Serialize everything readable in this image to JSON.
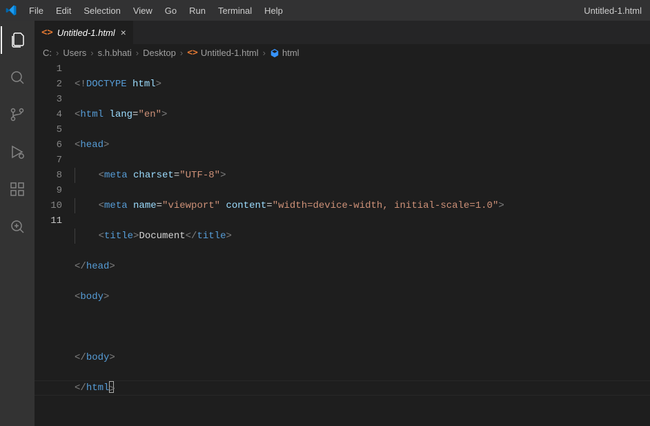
{
  "titlebar": {
    "title": "Untitled-1.html",
    "menu": [
      "File",
      "Edit",
      "Selection",
      "View",
      "Go",
      "Run",
      "Terminal",
      "Help"
    ]
  },
  "activitybar": {
    "items": [
      {
        "name": "explorer"
      },
      {
        "name": "search"
      },
      {
        "name": "source-control"
      },
      {
        "name": "run-debug"
      },
      {
        "name": "extensions"
      },
      {
        "name": "zoom"
      }
    ]
  },
  "tabs": [
    {
      "label": "Untitled-1.html",
      "icon": "<>",
      "active": true
    }
  ],
  "breadcrumbs": {
    "parts": [
      "C:",
      "Users",
      "s.h.bhati",
      "Desktop"
    ],
    "file": "Untitled-1.html",
    "symbol": "html"
  },
  "editor": {
    "lineCount": 11,
    "activeLine": 11,
    "tokens": {
      "l1": {
        "a": "<!",
        "b": "DOCTYPE",
        "c": " html",
        "d": ">"
      },
      "l2": {
        "a": "<",
        "b": "html",
        "c": " lang",
        "d": "=",
        "e": "\"en\"",
        "f": ">"
      },
      "l3": {
        "a": "<",
        "b": "head",
        "c": ">"
      },
      "l4": {
        "a": "<",
        "b": "meta",
        "c": " charset",
        "d": "=",
        "e": "\"UTF-8\"",
        "f": ">"
      },
      "l5": {
        "a": "<",
        "b": "meta",
        "c": " name",
        "d": "=",
        "e": "\"viewport\"",
        "f": " content",
        "g": "=",
        "h": "\"width=device-width, initial-scale=1.0\"",
        "i": ">"
      },
      "l6": {
        "a": "<",
        "b": "title",
        "c": ">",
        "d": "Document",
        "e": "</",
        "f": "title",
        "g": ">"
      },
      "l7": {
        "a": "</",
        "b": "head",
        "c": ">"
      },
      "l8": {
        "a": "<",
        "b": "body",
        "c": ">"
      },
      "l9": {
        "blank": ""
      },
      "l10": {
        "a": "</",
        "b": "body",
        "c": ">"
      },
      "l11": {
        "a": "<",
        "b": "/",
        "c": "html",
        "d": ">"
      }
    }
  }
}
